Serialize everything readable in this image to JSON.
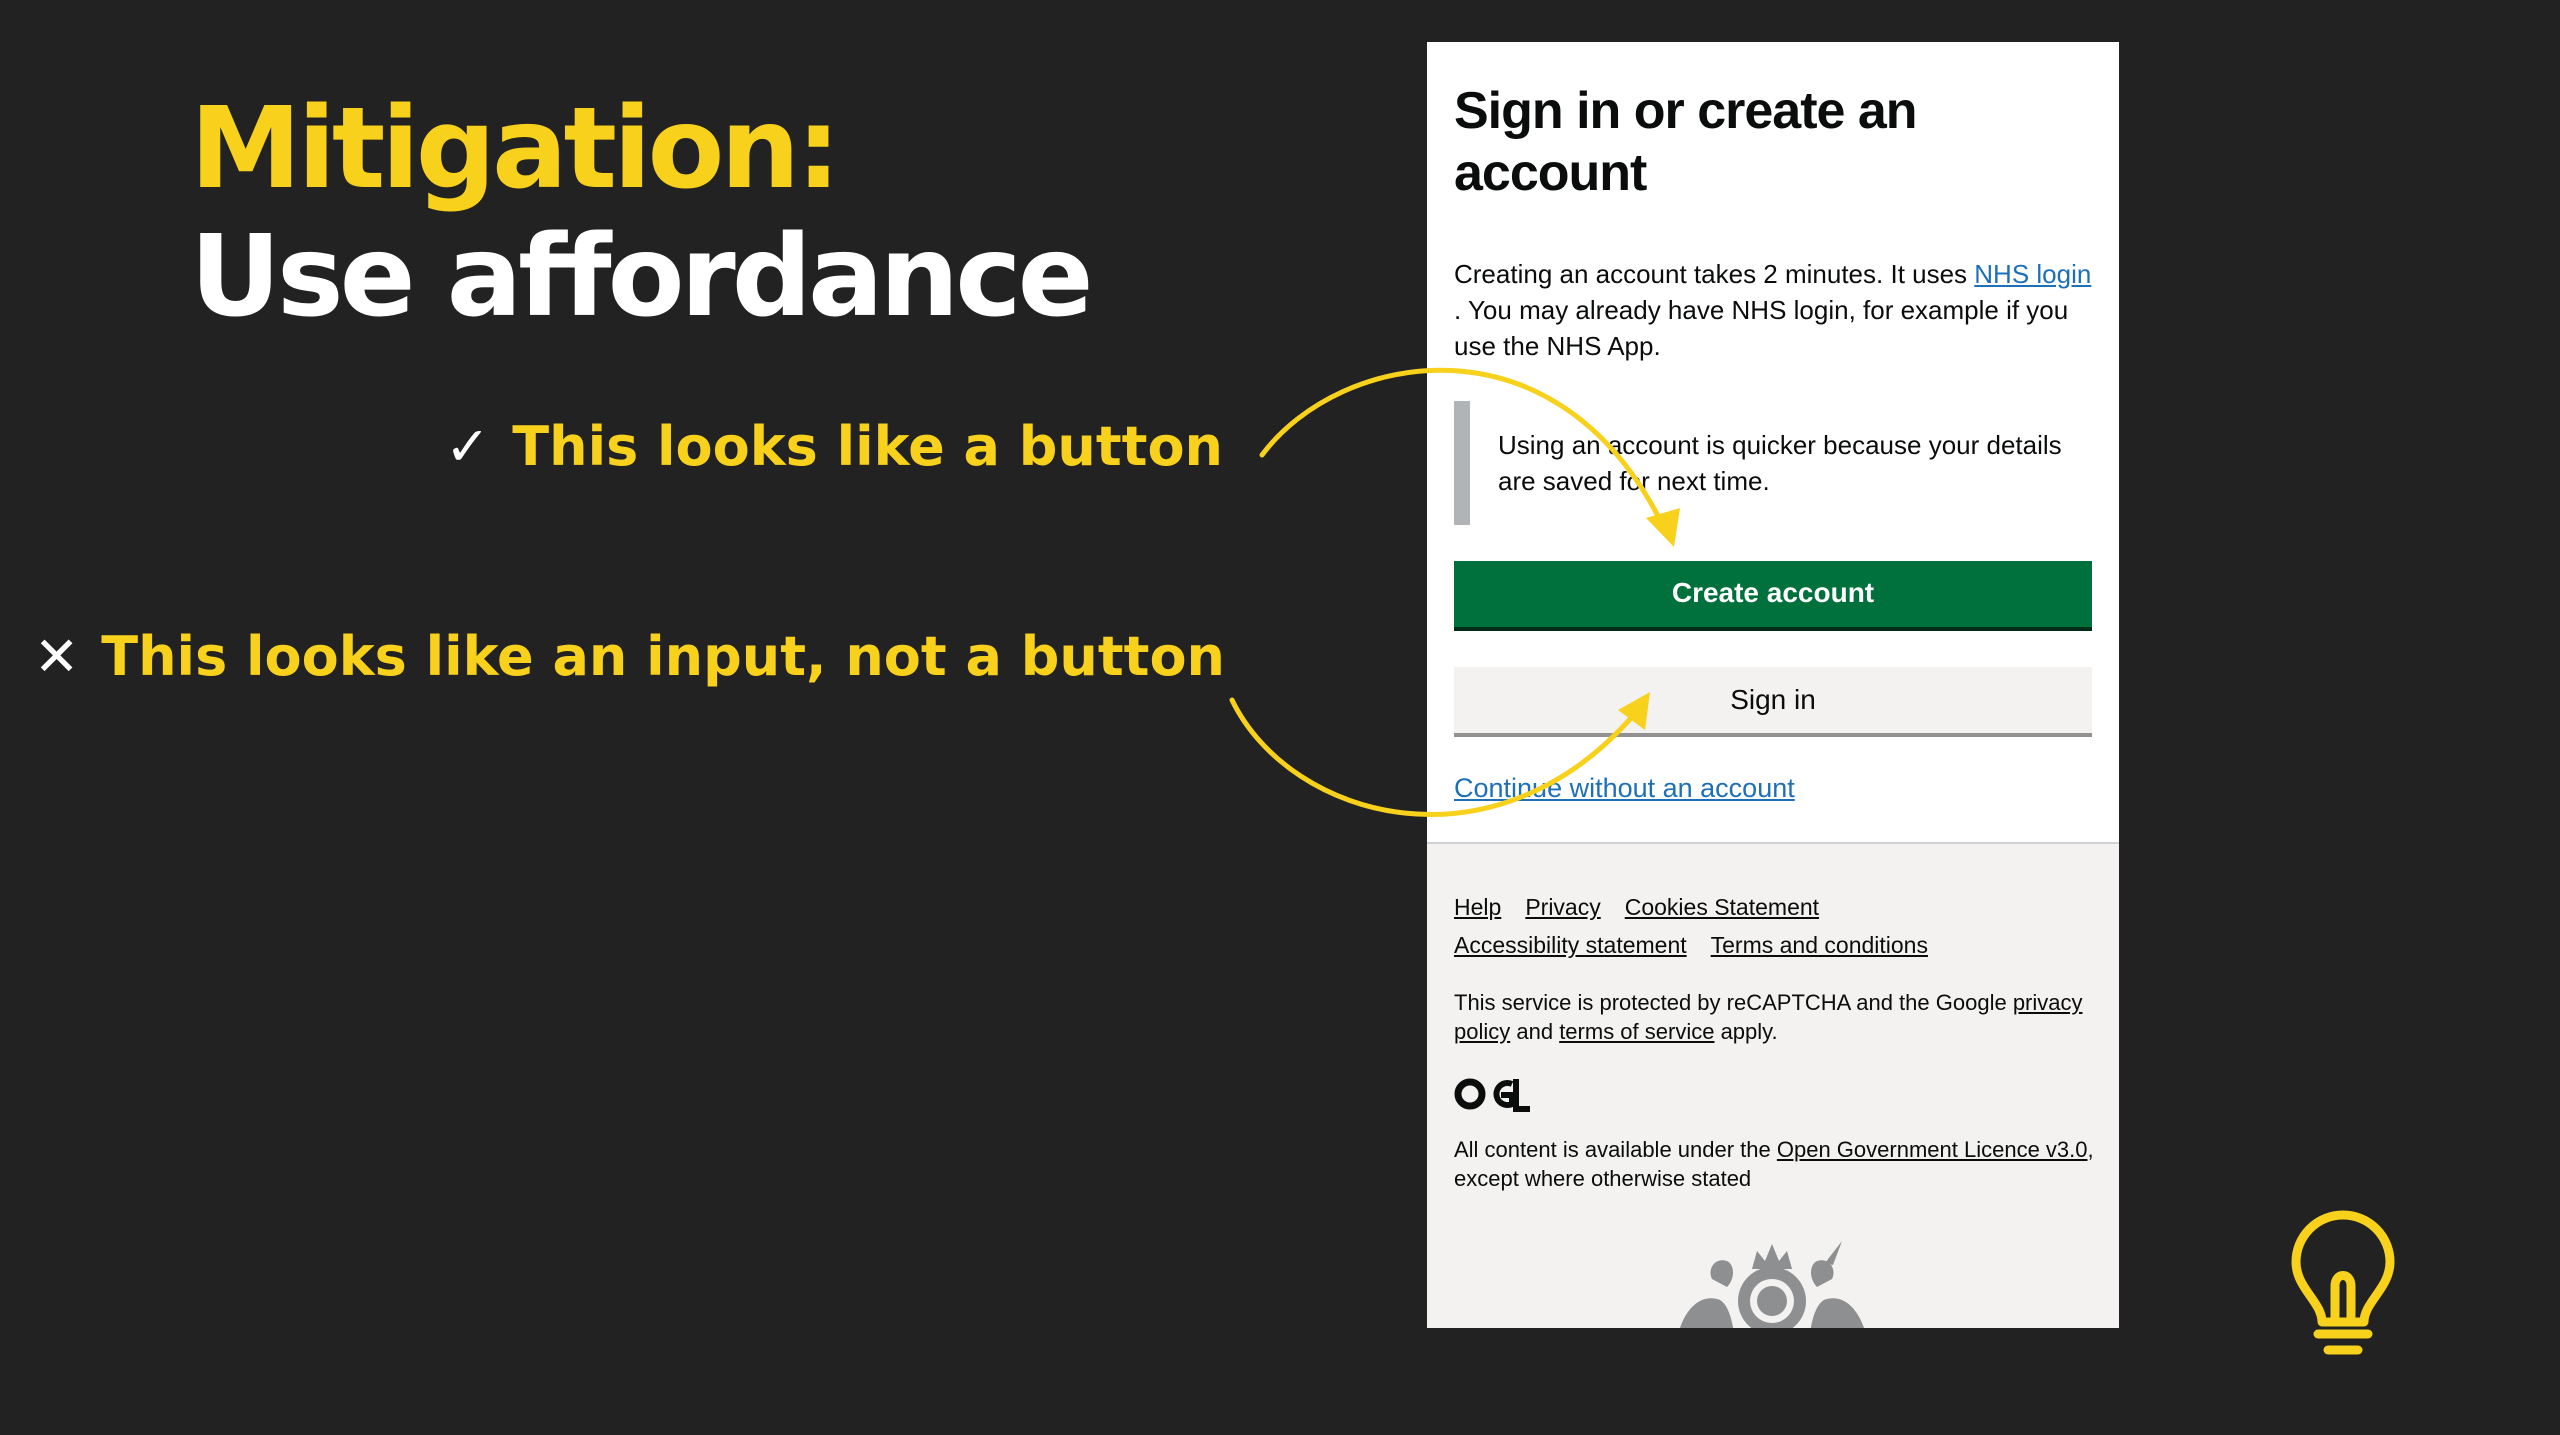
{
  "slide": {
    "title_line1": "Mitigation:",
    "title_line2": "Use affordance",
    "callout_good": {
      "mark": "✓",
      "text": "This looks like a button"
    },
    "callout_bad": {
      "mark": "✕",
      "text": "This looks like an input, not a button"
    },
    "accent_color": "#f7d11b",
    "background_color": "#222222",
    "bulb_icon": "lightbulb-icon"
  },
  "page": {
    "heading": "Sign in or create an account",
    "intro": {
      "text_before": "Creating an account takes 2 minutes. It uses ",
      "link": "NHS login ",
      "text_after": ". You may already have NHS login, for example if you use the NHS App."
    },
    "inset_text": "Using an account is quicker because your details are saved for next time.",
    "create_button": "Create account",
    "signin_button": "Sign in",
    "continue_link": "Continue without an account",
    "footer": {
      "links": [
        "Help",
        "Privacy",
        "Cookies Statement",
        "Accessibility statement",
        "Terms and conditions"
      ],
      "recaptcha_before": "This service is protected by reCAPTCHA and the Google ",
      "privacy_policy": "privacy policy",
      "recaptcha_and": " and ",
      "terms_of_service": "terms of service",
      "recaptcha_after": " apply.",
      "ogl_logo": "OGL",
      "licence_before": "All content is available under the ",
      "licence_link": "Open Government Licence v3.0",
      "licence_after": ", except where otherwise stated"
    },
    "colors": {
      "create_green": "#00703c",
      "link_blue": "#1d70b8",
      "footer_bg": "#f3f2f1"
    }
  }
}
